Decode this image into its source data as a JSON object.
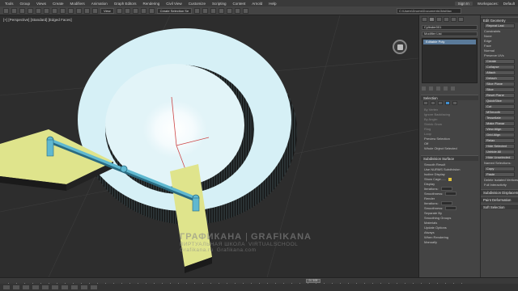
{
  "menubar": {
    "items": [
      "Tools",
      "Group",
      "Views",
      "Create",
      "Modifiers",
      "Animation",
      "Graph Editors",
      "Rendering",
      "Civil View",
      "Customize",
      "Scripting",
      "Content",
      "Arnold",
      "Help"
    ],
    "signin": "Sign In",
    "workspaces_label": "Workspaces:",
    "workspace_value": "Default"
  },
  "toolbar": {
    "view_dropdown": "View",
    "selection_set": "Create Selection Se",
    "path": "C:\\Users\\Drums\\Documents\\3dsMax"
  },
  "viewport": {
    "label": "[+] [Perspective] [Standard] [Edged Faces]"
  },
  "watermark": {
    "left_big": "ГРАФИКАНА",
    "right_big": "GRAFIKANA",
    "left_small": "ВИРТУАЛЬНАЯ ШКОЛА",
    "right_small": "VIRTUALSCHOOL",
    "left_url": "Grafikana.ru",
    "right_url": "Grafikana.com"
  },
  "command_panel": {
    "object_name": "Cylinder001",
    "modifier_list": "Modifier List",
    "stack_item": "Editable Poly",
    "selection": {
      "title": "Selection",
      "rows": [
        "By Vertex",
        "Ignore Backfacing",
        "By Angle:",
        "Shrink  Grow",
        "Ring",
        "Loop"
      ],
      "preview_label": "Preview Selection",
      "preview_value": "Off",
      "status": "Whole Object Selected"
    },
    "subdivision": {
      "title": "Subdivision Surface",
      "rows": [
        "Smooth Result",
        "Use NURMS Subdivision",
        "Isoline Display",
        "Show Cage......"
      ],
      "display_label": "Display",
      "iterations_label": "Iterations:",
      "smoothness_label": "Smoothness:",
      "render_label": "Render",
      "separate_by": "Separate By",
      "smoothing_groups": "Smoothing Groups",
      "materials": "Materials",
      "update_options": "Update Options",
      "always": "Always",
      "when_rendering": "When Rendering",
      "manually": "Manually"
    }
  },
  "roll_panel": {
    "edit_geometry": "Edit Geometry",
    "repeat_last": "Repeat Last",
    "constraints": "Constraints",
    "none": "None",
    "edge": "Edge",
    "face": "Face",
    "normal": "Normal",
    "preserve_uvs": "Preserve UVs",
    "create": "Create",
    "collapse": "Collapse",
    "attach": "Attach",
    "detach": "Detach",
    "slice_plane": "Slice Plane",
    "slice": "Slice",
    "reset_plane": "Reset Plane",
    "quickslice": "QuickSlice",
    "cut": "Cut",
    "msmooth": "MSmooth",
    "tessellate": "Tessellate",
    "make_planar": "Make Planar",
    "view_align": "View Align",
    "grid_align": "Grid Align",
    "relax": "Relax",
    "hide_selected": "Hide Selected",
    "unhide_all": "Unhide All",
    "hide_unselected": "Hide Unselected",
    "named_selections": "Named Selections:",
    "copy": "Copy",
    "paste": "Paste",
    "delete_isolated": "Delete Isolated Vertices",
    "full_interactivity": "Full Interactivity",
    "subdivision_displacement": "Subdivision Displacement",
    "paint_deformation": "Paint Deformation",
    "soft_selection": "Soft Selection"
  },
  "timeline": {
    "slider": "0 / 100"
  },
  "scene": {
    "ring_color": "#d6f0f6",
    "ring_wall_color": "#1a1a1a",
    "bar_color": "#dfe48c",
    "rod_color": "#5fb8d0"
  }
}
